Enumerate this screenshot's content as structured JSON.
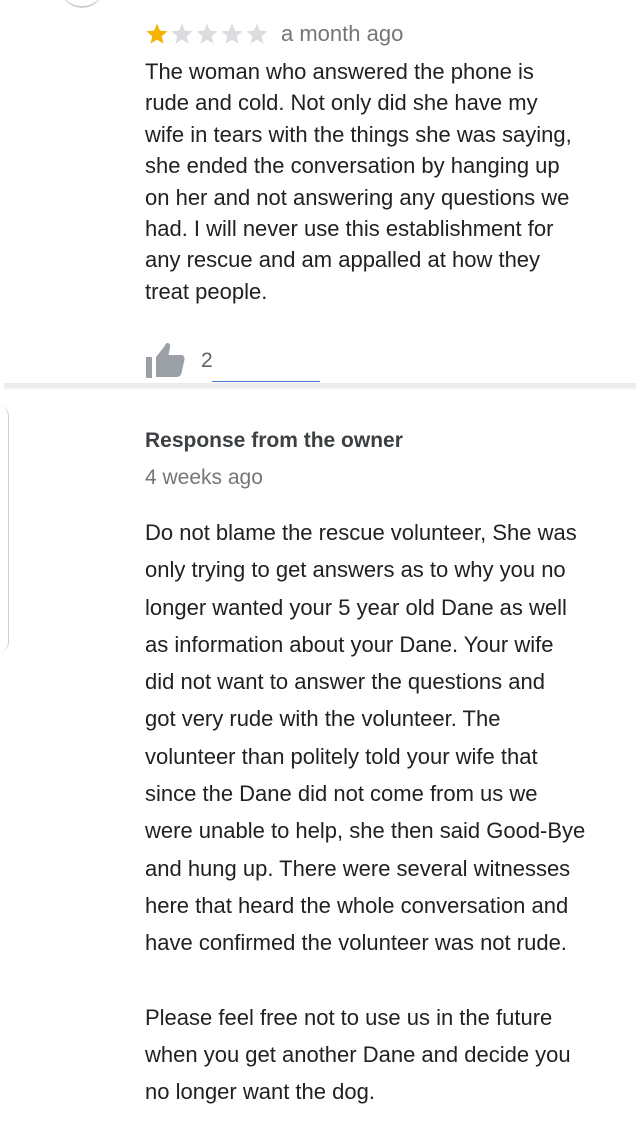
{
  "review": {
    "rating": 1,
    "max_rating": 5,
    "star_filled_color": "#f4b400",
    "star_empty_color": "#dadce0",
    "time": "a month ago",
    "text": "The woman who answered the phone is\nrude and cold. Not only did she have my\nwife in tears with the things she was saying,\nshe ended the conversation by hanging up\non her and not answering any questions we\nhad. I will never use this establishment for\nany rescue and am appalled at how they\ntreat people.",
    "likes": "2",
    "like_icon": "thumbs-up-icon"
  },
  "response": {
    "title": "Response from the owner",
    "time": "4 weeks ago",
    "text": "Do not blame the rescue volunteer, She was\nonly trying to get answers as to why you no\nlonger wanted your 5 year old Dane as well\nas information about your Dane. Your wife\ndid not want to answer the questions and\ngot very rude with the volunteer. The\nvolunteer than politely told your wife that\nsince the Dane did not come from us we\nwere unable to help, she then said Good-Bye\nand hung up. There were several witnesses\nhere that heard the whole conversation and\nhave confirmed the volunteer was not rude.\n\nPlease feel free not to use us in the future\nwhen you get another Dane and decide you\nno longer want the dog."
  }
}
